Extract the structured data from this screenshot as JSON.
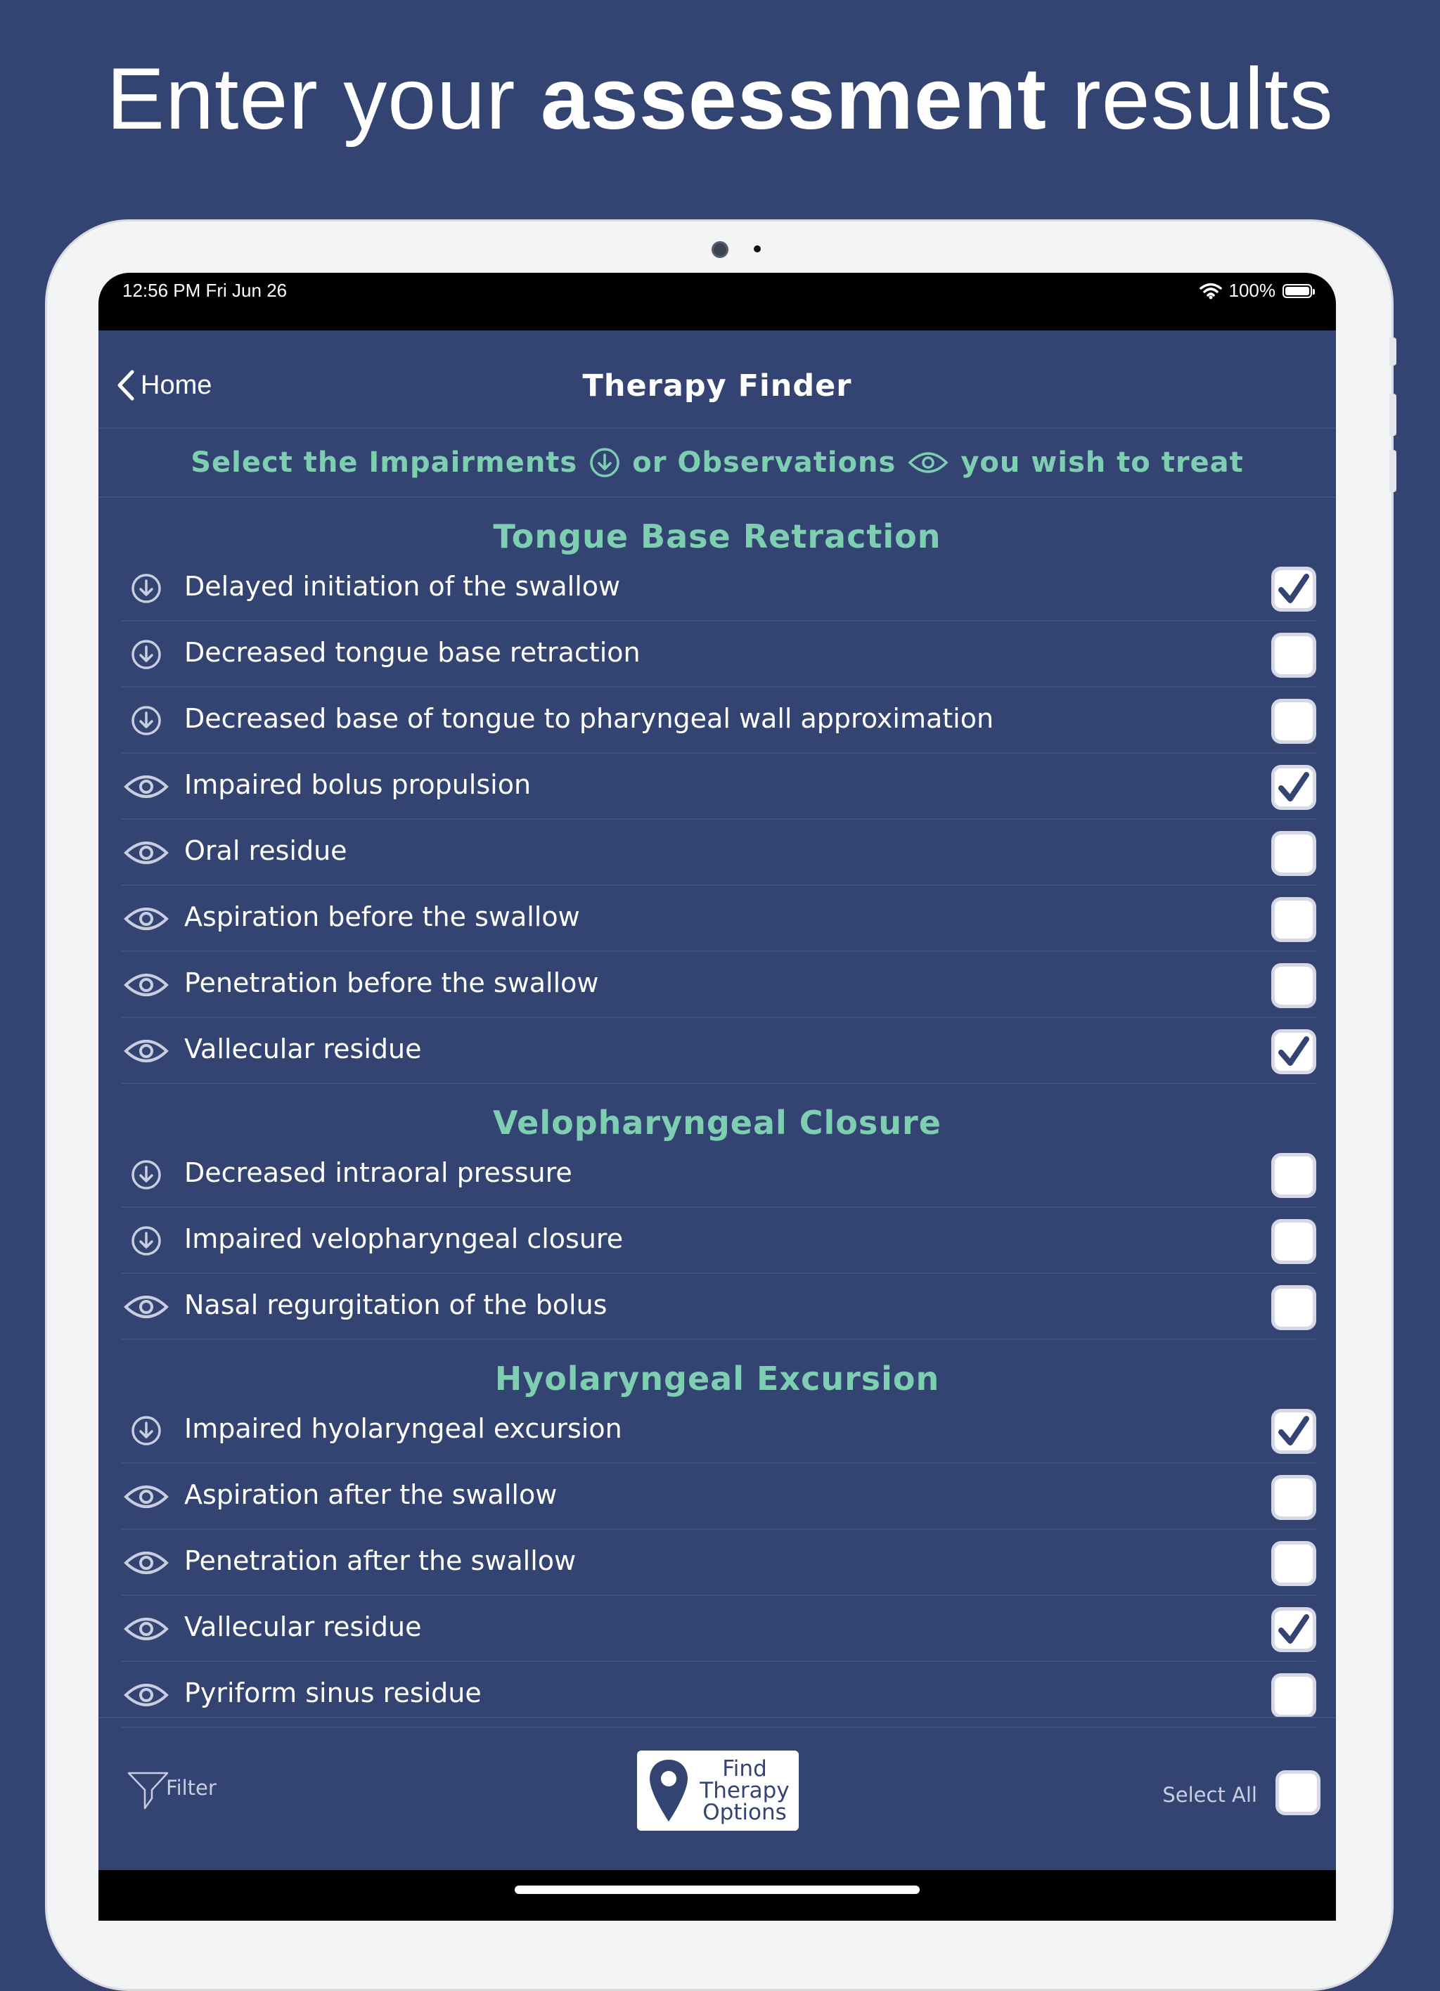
{
  "marketing": {
    "headline_pre": "Enter your ",
    "headline_bold": "assessment",
    "headline_post": " results"
  },
  "status_bar": {
    "time": "12:56 PM   Fri Jun 26",
    "battery": "100%",
    "battery_level": 1.0
  },
  "nav": {
    "back_label": "Home",
    "title": "Therapy Finder"
  },
  "instruction": {
    "part1": "Select the Impairments",
    "part2": "or Observations",
    "part3": "you wish to treat"
  },
  "colors": {
    "background": "#344472",
    "accent": "#7ecfb1",
    "text": "#ffffff"
  },
  "sections": [
    {
      "title": "Tongue Base Retraction",
      "items": [
        {
          "icon": "down-arrow-circle-icon",
          "label": "Delayed initiation of the swallow",
          "checked": true
        },
        {
          "icon": "down-arrow-circle-icon",
          "label": "Decreased tongue base retraction",
          "checked": false
        },
        {
          "icon": "down-arrow-circle-icon",
          "label": "Decreased base of tongue to pharyngeal wall approximation",
          "checked": false
        },
        {
          "icon": "eye-icon",
          "label": "Impaired bolus propulsion",
          "checked": true
        },
        {
          "icon": "eye-icon",
          "label": "Oral residue",
          "checked": false
        },
        {
          "icon": "eye-icon",
          "label": "Aspiration before the swallow",
          "checked": false
        },
        {
          "icon": "eye-icon",
          "label": "Penetration before the swallow",
          "checked": false
        },
        {
          "icon": "eye-icon",
          "label": "Vallecular residue",
          "checked": true
        }
      ]
    },
    {
      "title": "Velopharyngeal Closure",
      "items": [
        {
          "icon": "down-arrow-circle-icon",
          "label": "Decreased intraoral pressure",
          "checked": false
        },
        {
          "icon": "down-arrow-circle-icon",
          "label": "Impaired velopharyngeal closure",
          "checked": false
        },
        {
          "icon": "eye-icon",
          "label": "Nasal regurgitation of the bolus",
          "checked": false
        }
      ]
    },
    {
      "title": "Hyolaryngeal Excursion",
      "items": [
        {
          "icon": "down-arrow-circle-icon",
          "label": "Impaired hyolaryngeal excursion",
          "checked": true
        },
        {
          "icon": "eye-icon",
          "label": "Aspiration after the swallow",
          "checked": false
        },
        {
          "icon": "eye-icon",
          "label": "Penetration after the swallow",
          "checked": false
        },
        {
          "icon": "eye-icon",
          "label": "Vallecular residue",
          "checked": true
        },
        {
          "icon": "eye-icon",
          "label": "Pyriform sinus residue",
          "checked": false
        }
      ]
    }
  ],
  "footer": {
    "filter_label": "Filter",
    "find_button": [
      "Find",
      "Therapy",
      "Options"
    ],
    "select_all_label": "Select All",
    "select_all_checked": false
  }
}
